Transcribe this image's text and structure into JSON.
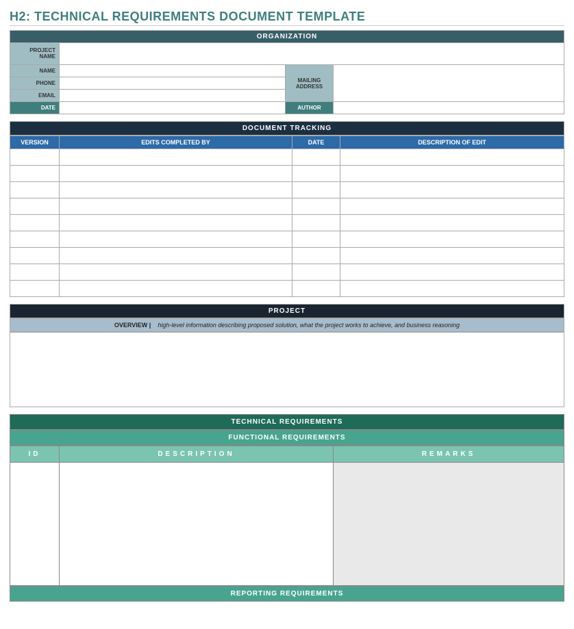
{
  "title": "H2: TECHNICAL REQUIREMENTS DOCUMENT TEMPLATE",
  "organization": {
    "header": "ORGANIZATION",
    "labels": {
      "project_name": "PROJECT NAME",
      "name": "NAME",
      "phone": "PHONE",
      "email": "EMAIL",
      "mailing_address": "MAILING ADDRESS",
      "date": "DATE",
      "author": "AUTHOR"
    },
    "values": {
      "project_name": "",
      "name": "",
      "phone": "",
      "email": "",
      "mailing_address": "",
      "date": "",
      "author": ""
    }
  },
  "document_tracking": {
    "header": "DOCUMENT TRACKING",
    "columns": {
      "version": "VERSION",
      "edits_by": "EDITS COMPLETED BY",
      "date": "DATE",
      "description": "DESCRIPTION OF EDIT"
    },
    "rows": [
      {
        "version": "",
        "edits_by": "",
        "date": "",
        "description": ""
      },
      {
        "version": "",
        "edits_by": "",
        "date": "",
        "description": ""
      },
      {
        "version": "",
        "edits_by": "",
        "date": "",
        "description": ""
      },
      {
        "version": "",
        "edits_by": "",
        "date": "",
        "description": ""
      },
      {
        "version": "",
        "edits_by": "",
        "date": "",
        "description": ""
      },
      {
        "version": "",
        "edits_by": "",
        "date": "",
        "description": ""
      },
      {
        "version": "",
        "edits_by": "",
        "date": "",
        "description": ""
      },
      {
        "version": "",
        "edits_by": "",
        "date": "",
        "description": ""
      },
      {
        "version": "",
        "edits_by": "",
        "date": "",
        "description": ""
      }
    ]
  },
  "project": {
    "header": "PROJECT",
    "overview_label": "OVERVIEW   |",
    "overview_desc": "high-level information describing proposed solution, what the project works to achieve, and business reasoning",
    "body": ""
  },
  "technical": {
    "header": "TECHNICAL REQUIREMENTS",
    "functional_header": "FUNCTIONAL REQUIREMENTS",
    "columns": {
      "id": "ID",
      "description": "DESCRIPTION",
      "remarks": "REMARKS"
    },
    "rows": [
      {
        "id": "",
        "description": "",
        "remarks": ""
      }
    ],
    "reporting_header": "REPORTING REQUIREMENTS"
  }
}
